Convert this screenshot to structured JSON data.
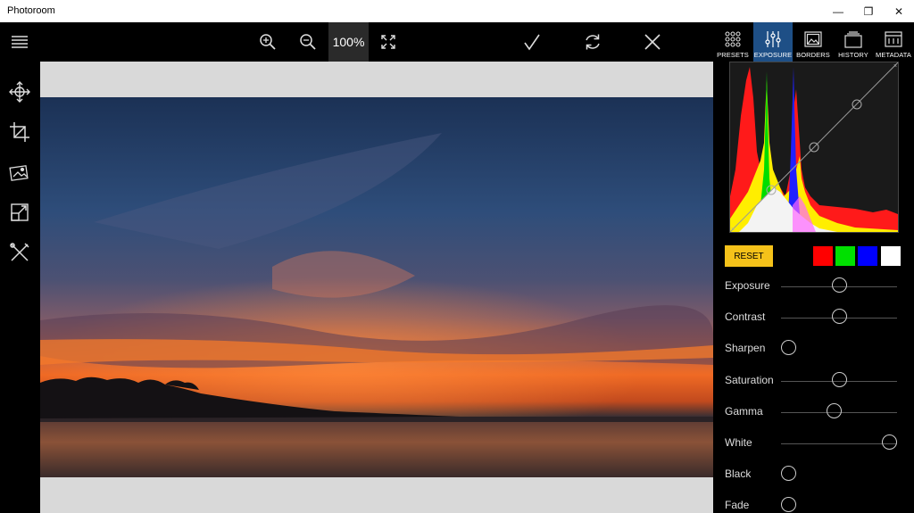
{
  "app": {
    "title": "Photoroom"
  },
  "window_controls": [
    {
      "name": "minimize-button",
      "glyph": "—"
    },
    {
      "name": "restore-button",
      "glyph": "❐"
    },
    {
      "name": "close-window-button",
      "glyph": "✕"
    }
  ],
  "toolbar": {
    "zoom_level": "100%",
    "tabs": [
      {
        "label": "PRESETS",
        "icon": "presets-grid-icon"
      },
      {
        "label": "EXPOSURE",
        "icon": "sliders-icon",
        "active": true
      },
      {
        "label": "BORDERS",
        "icon": "borders-image-icon"
      },
      {
        "label": "HISTORY",
        "icon": "history-stack-icon"
      },
      {
        "label": "METADATA",
        "icon": "metadata-icon"
      }
    ]
  },
  "left_tools": [
    "move-icon",
    "crop-icon",
    "image-effects-icon",
    "resize-icon",
    "tools-icon"
  ],
  "panel": {
    "reset_label": "RESET",
    "channels": [
      "#ff0000",
      "#00e000",
      "#0000ff",
      "#ffffff"
    ],
    "accent": "#f5c21a",
    "adjustments": [
      {
        "label": "Exposure",
        "value": 0.5,
        "track": true
      },
      {
        "label": "Contrast",
        "value": 0.5,
        "track": true
      },
      {
        "label": "Sharpen",
        "value": 0.0,
        "track": false
      },
      {
        "label": "Saturation",
        "value": 0.5,
        "track": true
      },
      {
        "label": "Gamma",
        "value": 0.45,
        "track": true
      },
      {
        "label": "White",
        "value": 1.0,
        "track": true
      },
      {
        "label": "Black",
        "value": 0.0,
        "track": false
      },
      {
        "label": "Fade",
        "value": 0.0,
        "track": false
      }
    ]
  }
}
